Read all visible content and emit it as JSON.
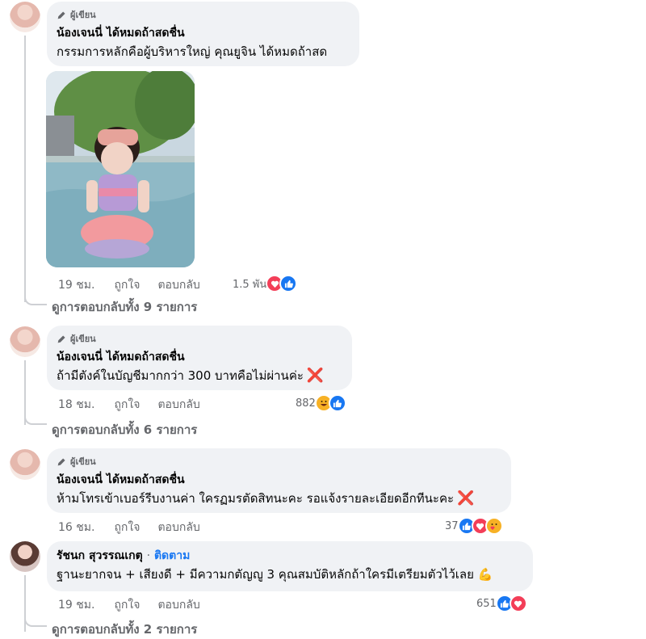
{
  "comments": [
    {
      "badge": "ผู้เขียน",
      "name": "น้องเจนนี่ ได้หมดถ้าสดชื่น",
      "text": "กรรมการหลักคือผู้บริหารใหญ่ คุณยูจิน ได้หมดถ้าสด",
      "time": "19 ชม.",
      "like": "ถูกใจ",
      "reply": "ตอบกลับ",
      "reaction_count": "1.5 พัน",
      "reactions": [
        "love",
        "like"
      ],
      "view_replies": "ดูการตอบกลับทั้ง 9 รายการ"
    },
    {
      "badge": "ผู้เขียน",
      "name": "น้องเจนนี่ ได้หมดถ้าสดชื่น",
      "text": "ถ้ามีตังค์ในบัญชีมากกว่า 300 บาทคือไม่ผ่านค่ะ",
      "emoji": "❌",
      "time": "18 ชม.",
      "like": "ถูกใจ",
      "reply": "ตอบกลับ",
      "reaction_count": "882",
      "reactions": [
        "haha",
        "like"
      ],
      "view_replies": "ดูการตอบกลับทั้ง 6 รายการ"
    },
    {
      "badge": "ผู้เขียน",
      "name": "น้องเจนนี่ ได้หมดถ้าสดชื่น",
      "text": "ห้ามโทรเข้าเบอร์รีบงานค่า ใครฏมรตัดสิทนะคะ รอแจ้งรายละเอียดอีกทีนะคะ",
      "emoji": "❌",
      "time": "16 ชม.",
      "like": "ถูกใจ",
      "reply": "ตอบกลับ",
      "reaction_count": "37",
      "reactions": [
        "like",
        "love",
        "care"
      ]
    },
    {
      "name": "รัชนก สุวรรณเกตุ",
      "follow": "ติดตาม",
      "separator": "·",
      "text": "ฐานะยากจน + เสียงดี + มีความกตัญญู 3 คุณสมบัติหลักถ้าใครมีเตรียมตัวไว้เลย",
      "emoji": "💪",
      "time": "19 ชม.",
      "like": "ถูกใจ",
      "reply": "ตอบกลับ",
      "reaction_count": "651",
      "reactions": [
        "like",
        "love"
      ],
      "view_replies": "ดูการตอบกลับทั้ง 2 รายการ"
    }
  ],
  "colors": {
    "like": "#1877f2",
    "love": "#f33e58",
    "haha": "#f7b125",
    "link": "#1877f2",
    "bubble": "#f0f2f5"
  },
  "icons": {
    "author_badge": "pencil-icon",
    "photo": "child-in-pool-photo"
  }
}
